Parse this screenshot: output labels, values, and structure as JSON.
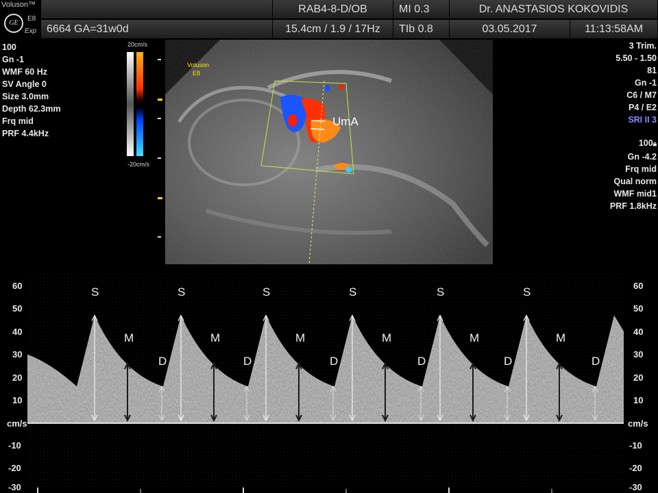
{
  "header": {
    "brand": "Voluson™",
    "logo_mark": "GE",
    "model": "E8",
    "mode": "Exp",
    "probe": "RAB4-8-D/OB",
    "mi": "MI  0.3",
    "doctor": "Dr. ANASTASIOS KOKOVIDIS",
    "patient_id": "6664  GA=31w0d",
    "depth_info": "15.4cm / 1.9 / 17Hz",
    "tib": "TIb  0.8",
    "date": "03.05.2017",
    "time": "11:13:58AM"
  },
  "left_params": [
    "100",
    "Gn  -1",
    "WMF 60 Hz",
    "SV Angle  0",
    "Size  3.0mm",
    "Depth 62.3mm",
    "Frq mid",
    "PRF  4.4kHz"
  ],
  "right_params_top": [
    "3 Trim.",
    "5.50 - 1.50",
    "81",
    "Gn  -1",
    "C6 / M7",
    "P4 / E2"
  ],
  "right_params_sri": "SRI II 3",
  "right_params_bottom": [
    "100",
    "Gn -4.2",
    "Frq mid",
    "Qual norm",
    "WMF mid1",
    "PRF  1.8kHz"
  ],
  "color_bar": {
    "top_label": "20cm/s",
    "bottom_label": "-20cm/s"
  },
  "image": {
    "watermark_line1": "Voluson",
    "watermark_line2": "E8",
    "vessel_label": "UmA"
  },
  "doppler": {
    "unit": "cm/s",
    "ticks_pos": [
      "60",
      "50",
      "40",
      "30",
      "20",
      "10"
    ],
    "ticks_neg": [
      "-10",
      "-20",
      "-30"
    ],
    "peak_labels": {
      "systolic": "S",
      "mean": "M",
      "diastolic": "D"
    },
    "cycle_count": 6
  },
  "colors": {
    "background": "#000000",
    "flow_red": "#ff3000",
    "flow_blue": "#1a55ff",
    "sample_gate": "#ffffff",
    "sector": "#c8e640"
  }
}
